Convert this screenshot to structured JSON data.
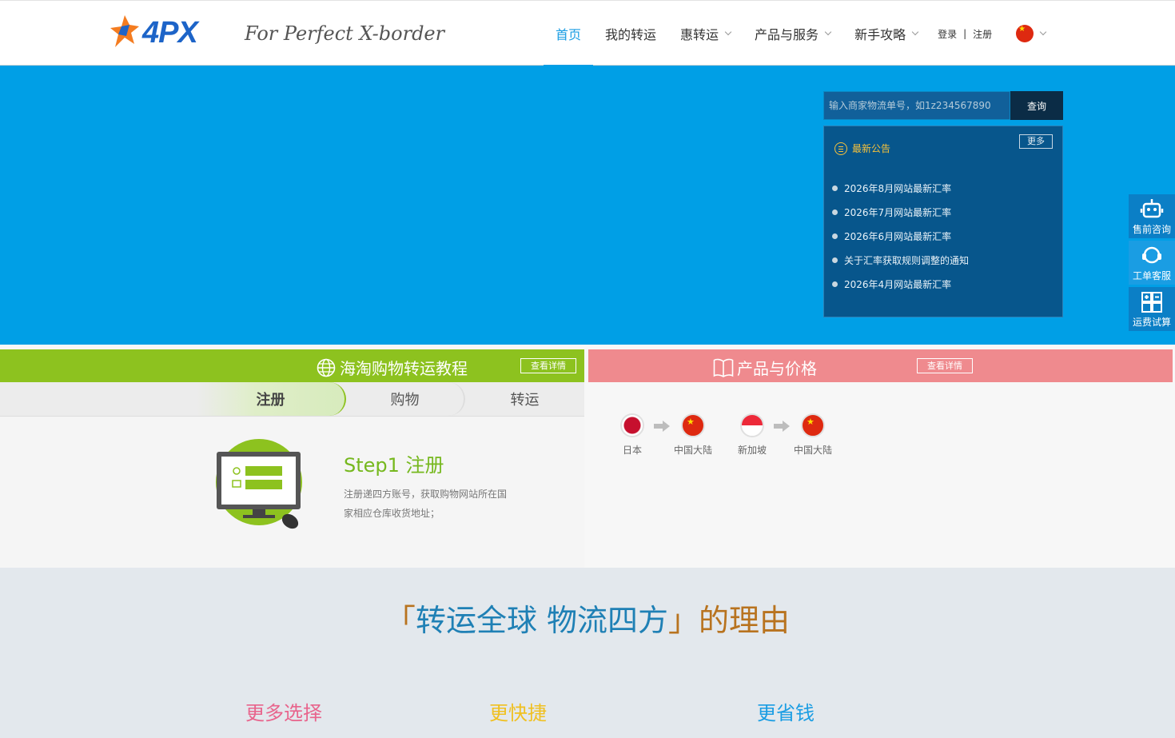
{
  "header": {
    "logo_text": "4PX",
    "slogan": "For Perfect X-border",
    "nav": [
      {
        "label": "首页",
        "active": true,
        "dropdown": false
      },
      {
        "label": "我的转运",
        "active": false,
        "dropdown": false
      },
      {
        "label": "惠转运",
        "active": false,
        "dropdown": true
      },
      {
        "label": "产品与服务",
        "active": false,
        "dropdown": true
      },
      {
        "label": "新手攻略",
        "active": false,
        "dropdown": true
      }
    ],
    "login": "登录",
    "separator": "|",
    "register": "注册",
    "language_icon": "china-flag-icon"
  },
  "search": {
    "placeholder": "输入商家物流单号，如1z234567890",
    "button": "查询"
  },
  "notice": {
    "title": "最新公告",
    "more": "更多",
    "items": [
      "2026年8月网站最新汇率",
      "2026年7月网站最新汇率",
      "2026年6月网站最新汇率",
      "关于汇率获取规则调整的通知",
      "2026年4月网站最新汇率"
    ]
  },
  "side_float": [
    {
      "label": "售前咨询",
      "icon": "robot-icon"
    },
    {
      "label": "工单客服",
      "icon": "headset-icon"
    },
    {
      "label": "运费试算",
      "icon": "calculator-icon"
    }
  ],
  "tutorial": {
    "title": "海淘购物转运教程",
    "detail": "查看详情",
    "tabs": [
      "注册",
      "购物",
      "转运"
    ],
    "step_title": "Step1 注册",
    "step_desc": "注册递四方账号，获取购物网站所在国家相应仓库收货地址；"
  },
  "products": {
    "title": "产品与价格",
    "detail": "查看详情",
    "routes": [
      {
        "from": "日本",
        "to": "中国大陆"
      },
      {
        "from": "新加坡",
        "to": "中国大陆"
      }
    ]
  },
  "reasons": {
    "title_open": "「",
    "title_main": "转运全球 物流四方",
    "title_close": "」",
    "title_suffix": "的理由",
    "items": [
      {
        "label": "更多选择",
        "color": "#e8648c"
      },
      {
        "label": "更快捷",
        "color": "#f0c020"
      },
      {
        "label": "更省钱",
        "color": "#1a9de3"
      }
    ]
  },
  "colors": {
    "brand_blue": "#1a9de3",
    "banner": "#009fe6",
    "tutorial_green": "#8dc21f",
    "product_pink": "#ef8a8e"
  }
}
